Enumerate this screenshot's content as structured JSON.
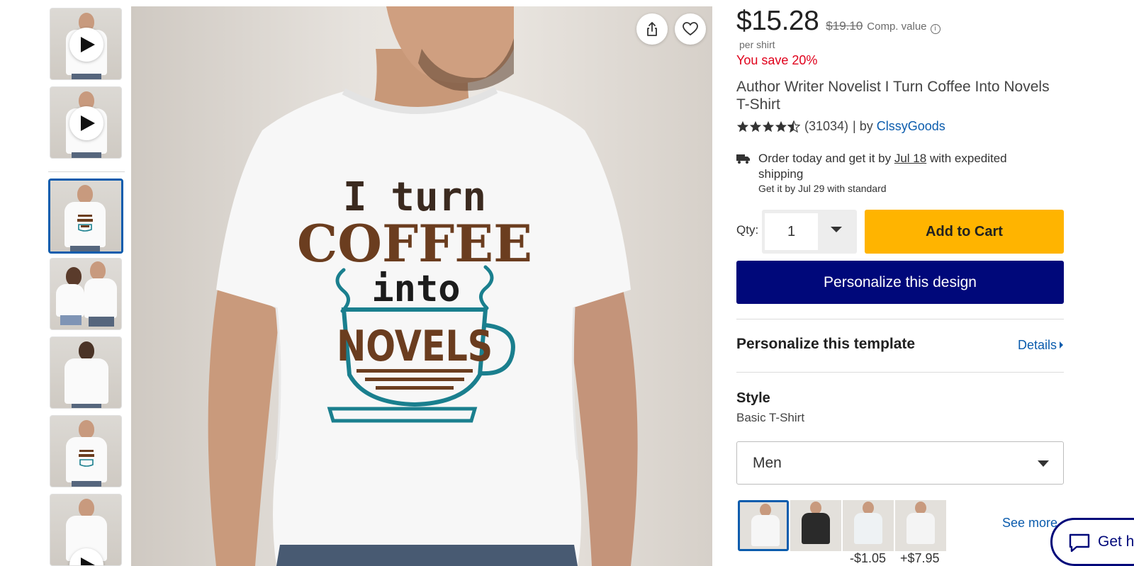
{
  "gallery": {
    "thumbnails": [
      {
        "kind": "video",
        "name": "video-1"
      },
      {
        "kind": "video",
        "name": "video-2"
      },
      {
        "kind": "image",
        "name": "front-print",
        "selected": true
      },
      {
        "kind": "image",
        "name": "couple"
      },
      {
        "kind": "image",
        "name": "back"
      },
      {
        "kind": "image",
        "name": "front-print-2"
      },
      {
        "kind": "video",
        "name": "video-3"
      }
    ],
    "print_lines": [
      "I turn",
      "COFFEE",
      "into",
      "NOVELS"
    ],
    "colors": {
      "brown": "#6b3d1f",
      "teal": "#1a7f8e"
    }
  },
  "product": {
    "price": "$15.28",
    "comp_price": "$19.10",
    "comp_label": "Comp. value",
    "unit": "per shirt",
    "savings": "You save 20%",
    "title": "Author Writer Novelist I Turn Coffee Into Novels T-Shirt",
    "rating": 4.5,
    "review_count": "(31034)",
    "by_label": "| by",
    "designer": "ClssyGoods"
  },
  "shipping": {
    "prefix": "Order today and get it by",
    "date": "Jul 18",
    "suffix": "with expedited shipping",
    "standard": "Get it by Jul 29 with standard"
  },
  "purchase": {
    "qty_label": "Qty:",
    "qty_value": "1",
    "add_to_cart": "Add to Cart",
    "personalize_design": "Personalize this design"
  },
  "template": {
    "title": "Personalize this template",
    "details_link": "Details"
  },
  "style": {
    "label": "Style",
    "value": "Basic T-Shirt",
    "fit": "Men",
    "swatches": [
      {
        "name": "white-basic",
        "color": "#f6f6f6",
        "price": ""
      },
      {
        "name": "black-basic",
        "color": "#2a2a2a",
        "price": ""
      },
      {
        "name": "light-tee",
        "color": "#eef2f4",
        "price": "-$1.05"
      },
      {
        "name": "white-premium",
        "color": "#f4f4f4",
        "price": "+$7.95"
      }
    ],
    "see_more": "See more"
  },
  "help": {
    "label": "Get he"
  },
  "colors": {
    "accent": "#0b5cad",
    "cart": "#ffb400",
    "primary": "#00087a",
    "sale": "#e0001b"
  }
}
